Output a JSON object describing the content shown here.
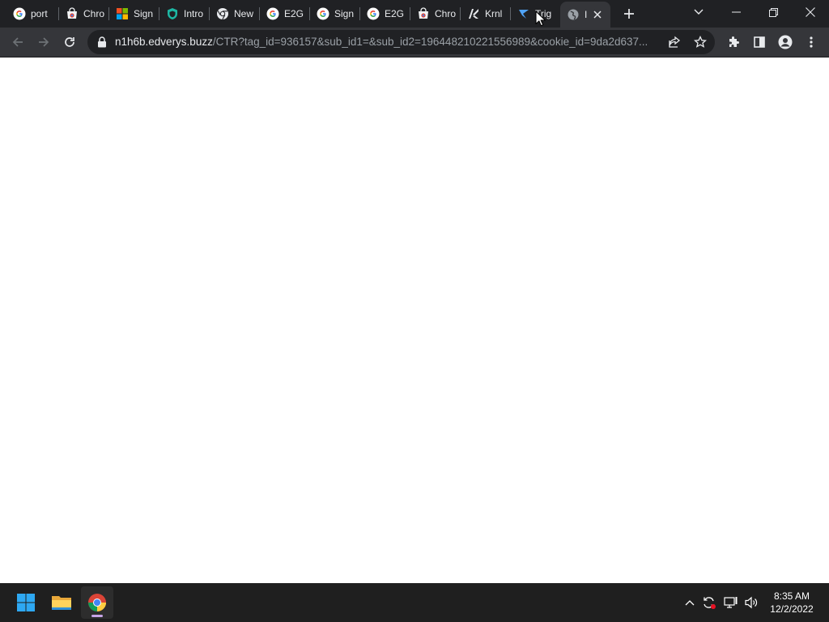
{
  "tabs": [
    {
      "label": "port",
      "icon": "google-icon"
    },
    {
      "label": "Chro",
      "icon": "chrome-web-store-icon"
    },
    {
      "label": "Sign",
      "icon": "microsoft-icon"
    },
    {
      "label": "Intro",
      "icon": "shield-icon"
    },
    {
      "label": "New",
      "icon": "chrome-icon"
    },
    {
      "label": "E2G",
      "icon": "google-icon"
    },
    {
      "label": "Sign",
      "icon": "google-icon"
    },
    {
      "label": "E2G",
      "icon": "google-icon"
    },
    {
      "label": "Chro",
      "icon": "chrome-web-store-icon"
    },
    {
      "label": "Krnl",
      "icon": "krnl-icon"
    },
    {
      "label": "Trig",
      "icon": "trigger-icon"
    },
    {
      "label": "I",
      "icon": "globe-icon",
      "active": true
    }
  ],
  "omnibox": {
    "host": "n1h6b.edverys.buzz",
    "path": "/CTR?tag_id=936157&sub_id1=&sub_id2=196448210221556989&cookie_id=9da2d637..."
  },
  "taskbar": {
    "time": "8:35 AM",
    "date": "12/2/2022"
  },
  "colors": {
    "tab_strip": "#202124",
    "toolbar": "#35363a",
    "omnibox": "#202124",
    "taskbar": "#1f1f1f",
    "page": "#ffffff"
  }
}
